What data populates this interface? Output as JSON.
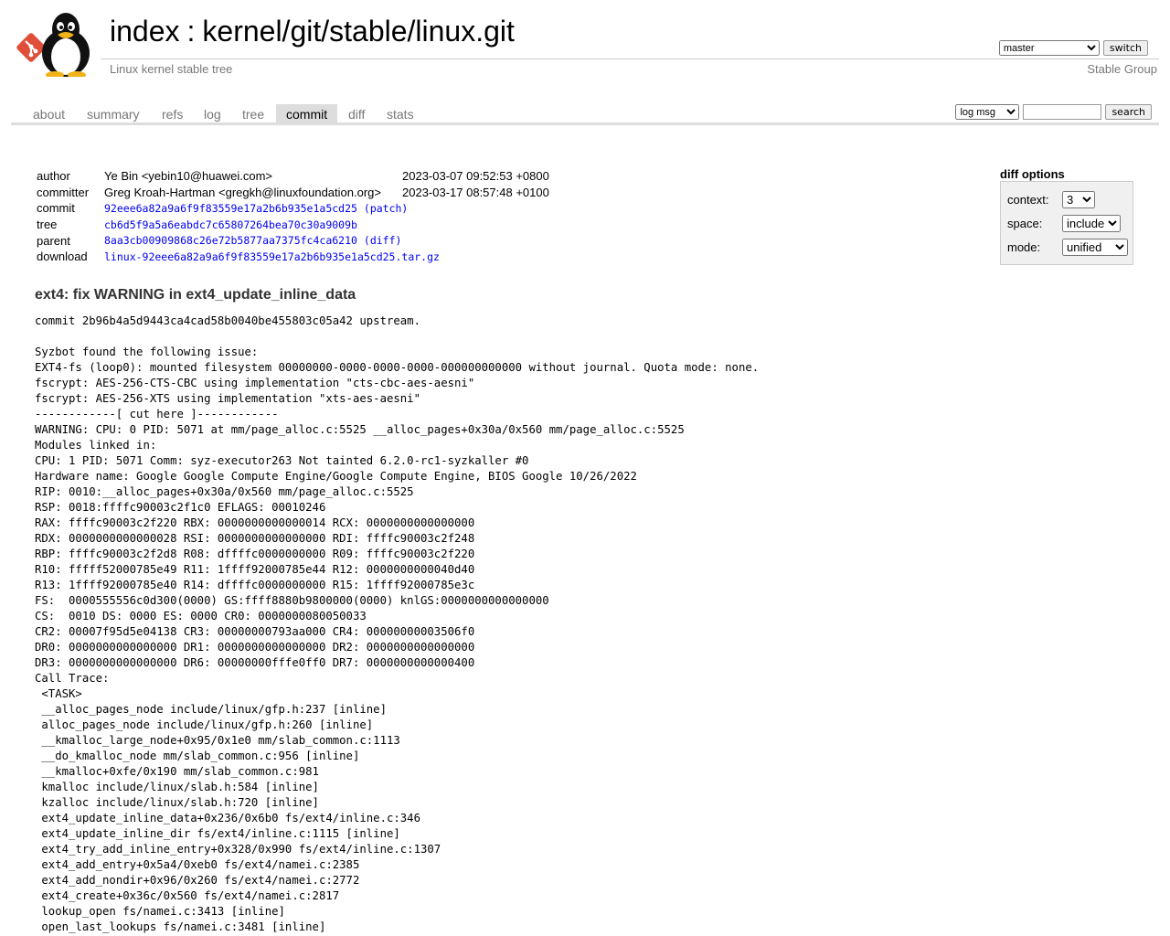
{
  "header": {
    "logo_icon": "git-logo-icon",
    "mascot_icon": "tux-penguin-icon",
    "index_link": "index",
    "separator": ":",
    "repo_path": "kernel/git/stable/linux.git",
    "subtitle": "Linux kernel stable tree",
    "branch_selected": "master",
    "switch_label": "switch",
    "owner": "Stable Group"
  },
  "tabs": {
    "about": "about",
    "summary": "summary",
    "refs": "refs",
    "log": "log",
    "tree": "tree",
    "commit": "commit",
    "diff": "diff",
    "stats": "stats",
    "active": "commit"
  },
  "search": {
    "mode_selected": "log msg",
    "query": "",
    "button_label": "search"
  },
  "commit_info": {
    "author_label": "author",
    "author": "Ye Bin <yebin10@huawei.com>",
    "author_date": "2023-03-07 09:52:53 +0800",
    "committer_label": "committer",
    "committer": "Greg Kroah-Hartman <gregkh@linuxfoundation.org>",
    "committer_date": "2023-03-17 08:57:48 +0100",
    "commit_label": "commit",
    "commit_hash": "92eee6a82a9a6f9f83559e17a2b6b935e1a5cd25",
    "patch_link": "(patch)",
    "tree_label": "tree",
    "tree_hash": "cb6d5f9a5a6eabdc7c65807264bea70c30a9009b",
    "parent_label": "parent",
    "parent_hash": "8aa3cb00909868c26e72b5877aa7375fc4ca6210",
    "diff_link": "(diff)",
    "download_label": "download",
    "download_file": "linux-92eee6a82a9a6f9f83559e17a2b6b935e1a5cd25.tar.gz"
  },
  "diff_options": {
    "title": "diff options",
    "context_label": "context:",
    "context_value": "3",
    "space_label": "space:",
    "space_value": "include",
    "mode_label": "mode:",
    "mode_value": "unified"
  },
  "message": {
    "subject": "ext4: fix WARNING in ext4_update_inline_data",
    "body": "commit 2b96b4a5d9443ca4cad58b0040be455803c05a42 upstream.\n\nSyzbot found the following issue:\nEXT4-fs (loop0): mounted filesystem 00000000-0000-0000-0000-000000000000 without journal. Quota mode: none.\nfscrypt: AES-256-CTS-CBC using implementation \"cts-cbc-aes-aesni\"\nfscrypt: AES-256-XTS using implementation \"xts-aes-aesni\"\n------------[ cut here ]------------\nWARNING: CPU: 0 PID: 5071 at mm/page_alloc.c:5525 __alloc_pages+0x30a/0x560 mm/page_alloc.c:5525\nModules linked in:\nCPU: 1 PID: 5071 Comm: syz-executor263 Not tainted 6.2.0-rc1-syzkaller #0\nHardware name: Google Google Compute Engine/Google Compute Engine, BIOS Google 10/26/2022\nRIP: 0010:__alloc_pages+0x30a/0x560 mm/page_alloc.c:5525\nRSP: 0018:ffffc90003c2f1c0 EFLAGS: 00010246\nRAX: ffffc90003c2f220 RBX: 0000000000000014 RCX: 0000000000000000\nRDX: 0000000000000028 RSI: 0000000000000000 RDI: ffffc90003c2f248\nRBP: ffffc90003c2f2d8 R08: dffffc0000000000 R09: ffffc90003c2f220\nR10: fffff52000785e49 R11: 1ffff92000785e44 R12: 0000000000040d40\nR13: 1ffff92000785e40 R14: dffffc0000000000 R15: 1ffff92000785e3c\nFS:  0000555556c0d300(0000) GS:ffff8880b9800000(0000) knlGS:0000000000000000\nCS:  0010 DS: 0000 ES: 0000 CR0: 0000000080050033\nCR2: 00007f95d5e04138 CR3: 00000000793aa000 CR4: 00000000003506f0\nDR0: 0000000000000000 DR1: 0000000000000000 DR2: 0000000000000000\nDR3: 0000000000000000 DR6: 00000000fffe0ff0 DR7: 0000000000000400\nCall Trace:\n <TASK>\n __alloc_pages_node include/linux/gfp.h:237 [inline]\n alloc_pages_node include/linux/gfp.h:260 [inline]\n __kmalloc_large_node+0x95/0x1e0 mm/slab_common.c:1113\n __do_kmalloc_node mm/slab_common.c:956 [inline]\n __kmalloc+0xfe/0x190 mm/slab_common.c:981\n kmalloc include/linux/slab.h:584 [inline]\n kzalloc include/linux/slab.h:720 [inline]\n ext4_update_inline_data+0x236/0x6b0 fs/ext4/inline.c:346\n ext4_update_inline_dir fs/ext4/inline.c:1115 [inline]\n ext4_try_add_inline_entry+0x328/0x990 fs/ext4/inline.c:1307\n ext4_add_entry+0x5a4/0xeb0 fs/ext4/namei.c:2385\n ext4_add_nondir+0x96/0x260 fs/ext4/namei.c:2772\n ext4_create+0x36c/0x560 fs/ext4/namei.c:2817\n lookup_open fs/namei.c:3413 [inline]\n open_last_lookups fs/namei.c:3481 [inline]"
  }
}
